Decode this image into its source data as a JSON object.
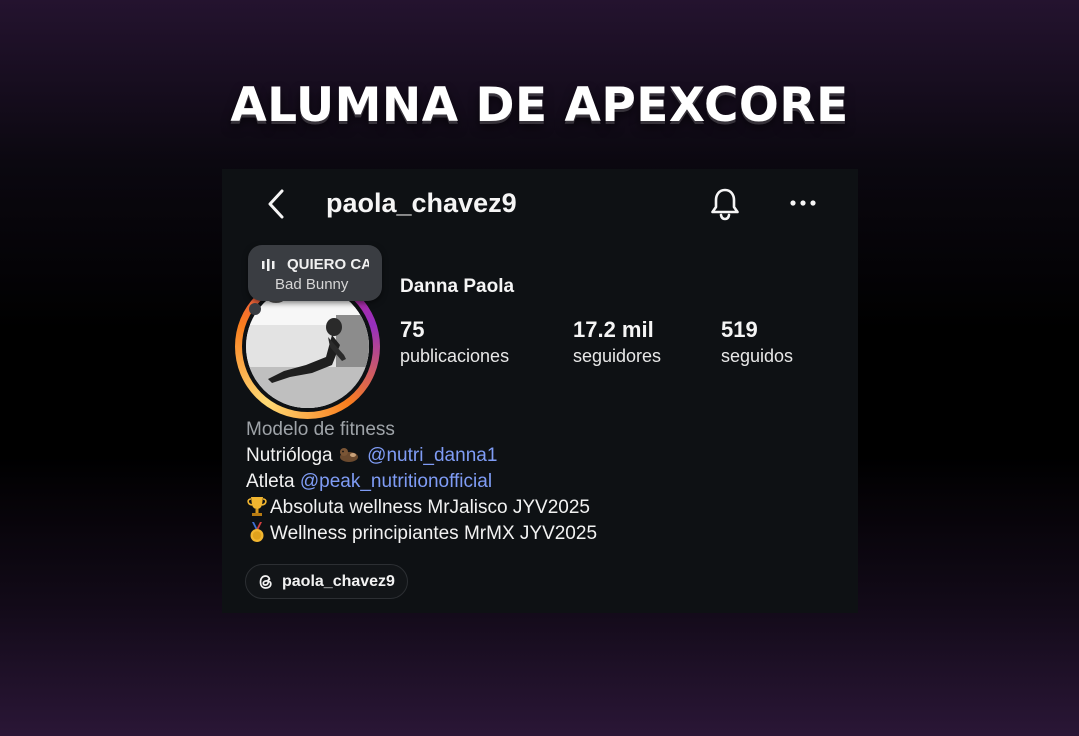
{
  "headline": "ALUMNA DE APEXCORE",
  "profile": {
    "username": "paola_chavez9",
    "display_name": "Danna Paola",
    "note": {
      "song": "QUIERO CANTAR",
      "artist": "Bad Bunny"
    },
    "stats": [
      {
        "value": "75",
        "label": "publicaciones"
      },
      {
        "value": "17.2 mil",
        "label": "seguidores"
      },
      {
        "value": "519",
        "label": "seguidos"
      }
    ],
    "bio": {
      "category": "Modelo de fitness",
      "line1_text": "Nutrióloga",
      "line1_mention": "@nutri_danna1",
      "line2_text": "Atleta",
      "line2_mention": "@peak_nutritionofficial",
      "line3_text": "Absoluta wellness MrJalisco JYV2025",
      "line4_text": "Wellness principiantes MrMX JYV2025"
    },
    "threads_handle": "paola_chavez9"
  },
  "icons": {
    "back": "chevron-left-icon",
    "bell": "bell-icon",
    "more": "more-horizontal-icon",
    "threads": "threads-icon",
    "trophy": "trophy-icon",
    "medal": "gold-medal-icon",
    "otter": "otter-emoji-icon"
  },
  "colors": {
    "mention": "#7f9cf5",
    "card_bg": "#0e1114",
    "ring_start": "#d62976",
    "ring_end": "#feda75"
  }
}
